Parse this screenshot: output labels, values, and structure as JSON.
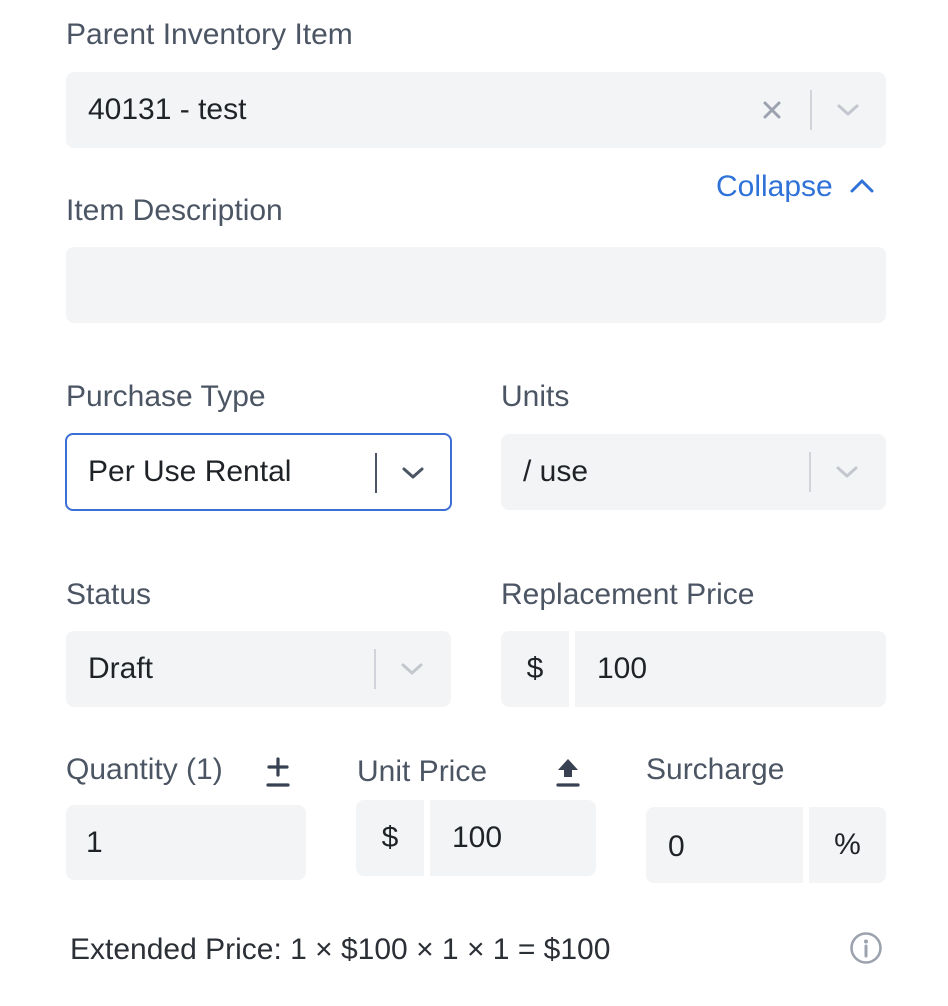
{
  "parent_item": {
    "label": "Parent Inventory Item",
    "value": "40131 - test",
    "clear_icon": "close-icon",
    "dropdown_icon": "chevron-down-icon"
  },
  "description": {
    "label": "Item Description",
    "value": "",
    "collapse_label": "Collapse"
  },
  "purchase_type": {
    "label": "Purchase Type",
    "value": "Per Use Rental"
  },
  "units": {
    "label": "Units",
    "value": "/ use"
  },
  "status": {
    "label": "Status",
    "value": "Draft"
  },
  "replacement_price": {
    "label": "Replacement Price",
    "prefix": "$",
    "value": "100"
  },
  "quantity": {
    "label": "Quantity (1)",
    "value": "1",
    "icon": "plus-minus-icon"
  },
  "unit_price": {
    "label": "Unit Price",
    "prefix": "$",
    "value": "100",
    "icon": "upload-arrow-icon"
  },
  "surcharge": {
    "label": "Surcharge",
    "value": "0",
    "suffix": "%"
  },
  "extended_price": {
    "text": "Extended Price: 1 × $100 × 1 × 1 = $100",
    "info_icon": "info-icon"
  },
  "colors": {
    "accent": "#2f72d8",
    "focus_border": "#3b6fd4",
    "field_bg": "#f3f4f6",
    "label": "#4b5563"
  }
}
